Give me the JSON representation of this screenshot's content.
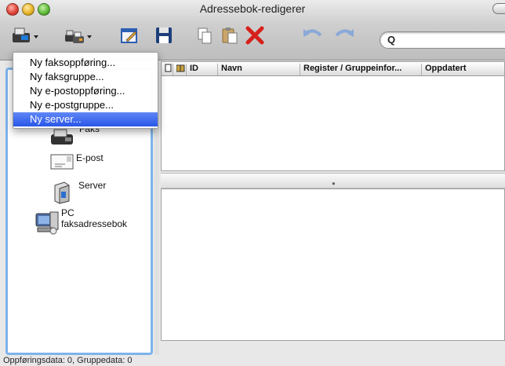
{
  "window": {
    "title": "Adressebok-redigerer"
  },
  "toolbar": {
    "buttons": [
      {
        "name": "new-entry-button",
        "icon": "fax-machine-icon",
        "has_dropdown": true
      },
      {
        "name": "new-group-button",
        "icon": "group-icon",
        "has_dropdown": true
      },
      {
        "name": "edit-button",
        "icon": "pencil-edit-icon"
      },
      {
        "name": "save-button",
        "icon": "floppy-disk-icon"
      },
      {
        "name": "copy-button",
        "icon": "copy-icon"
      },
      {
        "name": "paste-button",
        "icon": "paste-icon"
      },
      {
        "name": "delete-button",
        "icon": "red-x-icon"
      },
      {
        "name": "undo-button",
        "icon": "undo-arrow-icon"
      },
      {
        "name": "redo-button",
        "icon": "redo-arrow-icon"
      }
    ],
    "search": {
      "value": "",
      "placeholder": ""
    }
  },
  "menu": {
    "items": [
      {
        "label": "Ny faksoppføring...",
        "selected": false
      },
      {
        "label": "Ny faksgruppe...",
        "selected": false
      },
      {
        "label": "Ny e-postoppføring...",
        "selected": false
      },
      {
        "label": "Ny e-postgruppe...",
        "selected": false
      },
      {
        "label": "Ny server...",
        "selected": true
      }
    ]
  },
  "sidebar": {
    "items": [
      {
        "label": "Faks",
        "icon": "fax-machine-icon"
      },
      {
        "label": "E-post",
        "icon": "envelope-icon"
      },
      {
        "label": "Server",
        "icon": "server-icon"
      },
      {
        "label_line1": "PC",
        "label_line2": "faksadressebok",
        "icon": "pc-computer-icon"
      }
    ]
  },
  "table": {
    "columns": [
      "",
      "",
      "ID",
      "Navn",
      "Register / Gruppeinfor...",
      "Oppdatert"
    ],
    "rows": []
  },
  "statusbar": {
    "text": "Oppføringsdata: 0, Gruppedata: 0"
  },
  "colors": {
    "selection": "#2956e8",
    "sidebar_border": "#7eb3ea",
    "delete_red": "#d6201a"
  }
}
